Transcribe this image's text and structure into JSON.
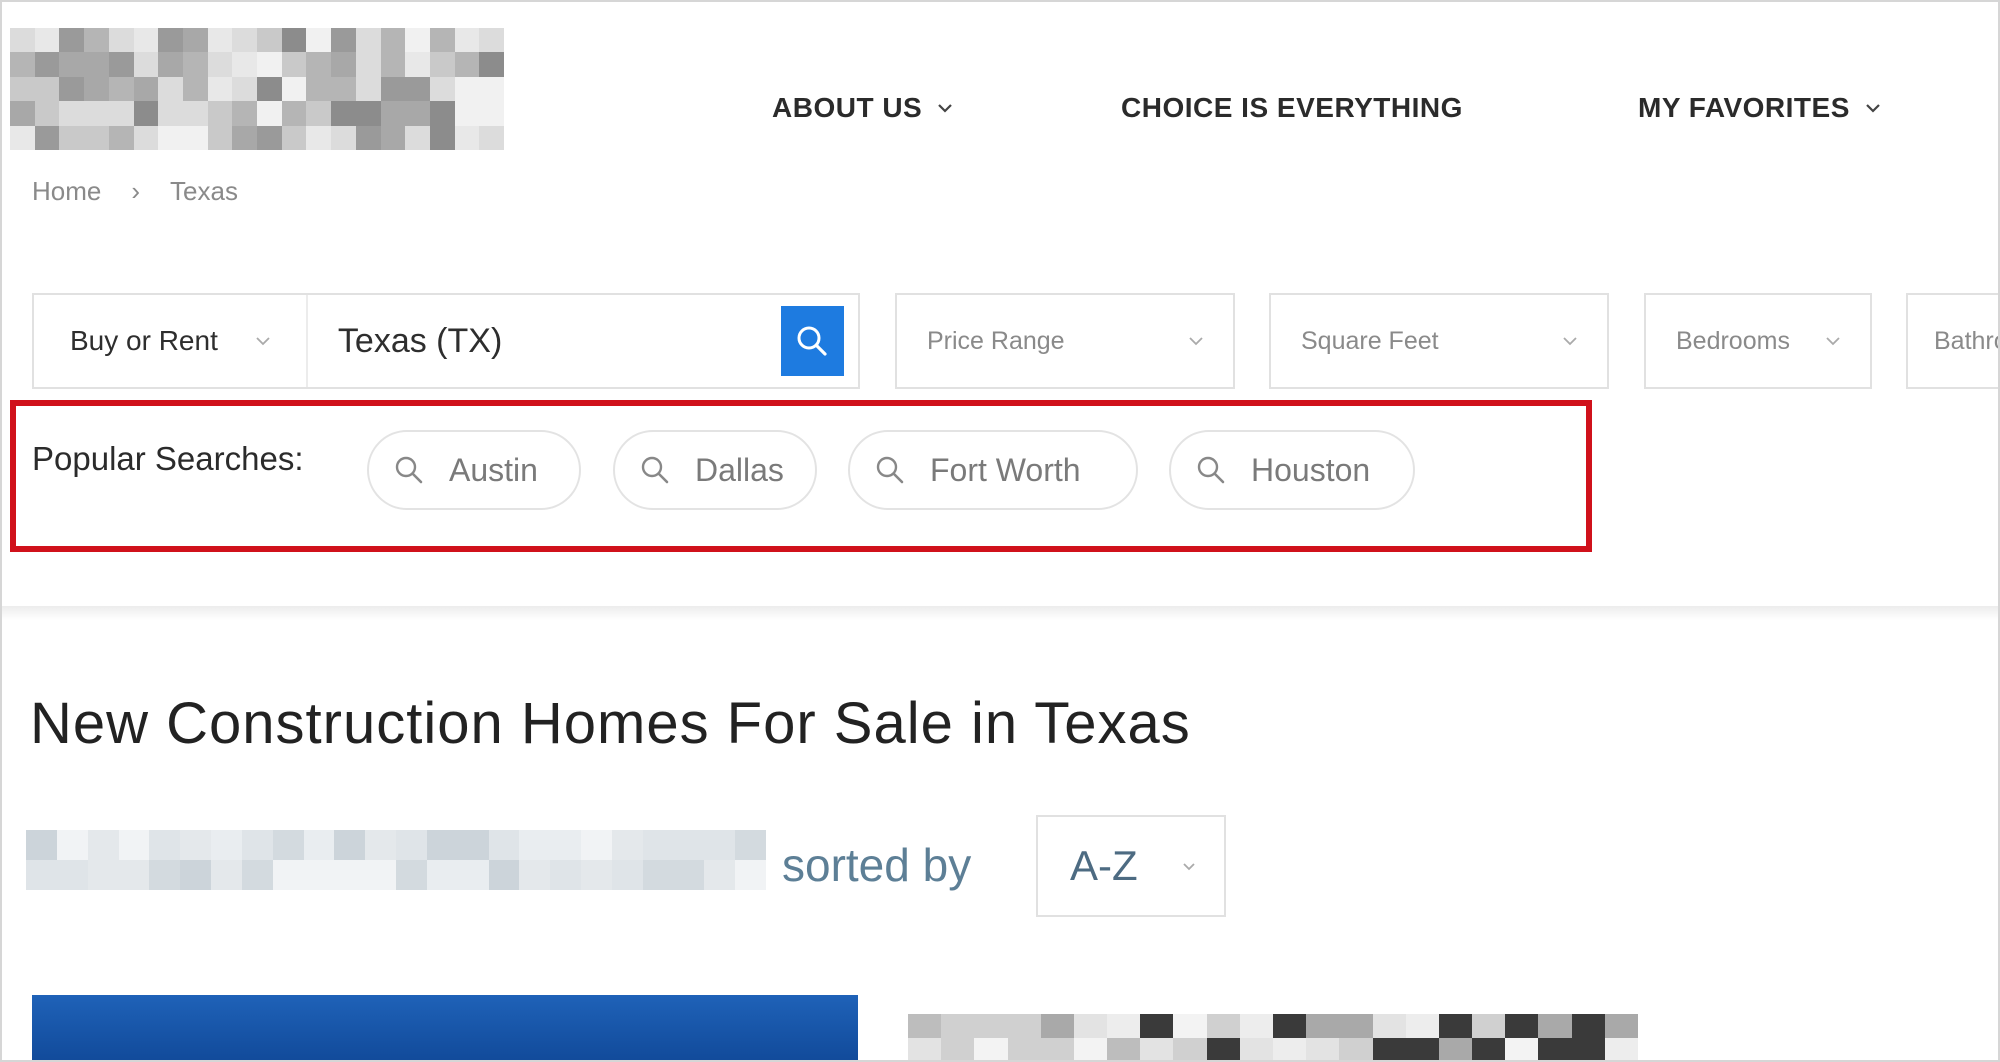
{
  "nav": {
    "items": [
      {
        "label": "ABOUT US",
        "has_dropdown": true
      },
      {
        "label": "CHOICE IS EVERYTHING",
        "has_dropdown": false
      },
      {
        "label": "MY FAVORITES",
        "has_dropdown": true
      }
    ]
  },
  "breadcrumb": {
    "home": "Home",
    "separator": "›",
    "current": "Texas"
  },
  "search": {
    "mode_label": "Buy or Rent",
    "location_value": "Texas (TX)",
    "button_icon": "search-icon",
    "accent_color": "#1e7be0"
  },
  "filters": {
    "price": "Price Range",
    "sqft": "Square Feet",
    "bedrooms": "Bedrooms",
    "bathrooms": "Bathrooms"
  },
  "popular": {
    "label": "Popular Searches:",
    "chips": [
      "Austin",
      "Dallas",
      "Fort Worth",
      "Houston"
    ],
    "highlight_color": "#d0111b"
  },
  "page": {
    "title": "New Construction Homes For Sale in Texas"
  },
  "results": {
    "sorted_by_label": "sorted by",
    "sort_value": "A-Z"
  }
}
